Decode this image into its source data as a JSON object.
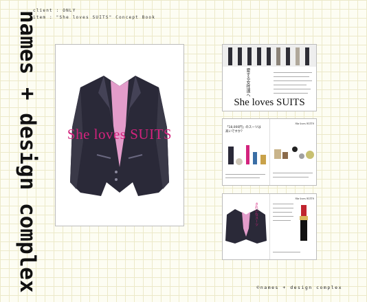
{
  "sidebar": {
    "title": "names + design complex"
  },
  "header": {
    "client_line": "client : ONLY",
    "item_line": "item : \"She loves SUITS\" Concept Book"
  },
  "main_visual": {
    "brand_text": "She loves SUITS"
  },
  "thumbnails": [
    {
      "brand_text": "She loves SUITS",
      "vertical_copy": "愛する女性達へ"
    },
    {
      "brand_text": "She loves SUITS",
      "title_text": "「18,000円」のスーツは高いですか？"
    },
    {
      "brand_text": "She loves SUITS",
      "vertical_copy": "きれいなスーツ"
    }
  ],
  "footer": {
    "copyright": "©names + design complex"
  },
  "colors": {
    "accent": "#d3237d",
    "grid": "#ece9c9",
    "background": "#fdfdf3",
    "jacket": "#2a2938"
  }
}
